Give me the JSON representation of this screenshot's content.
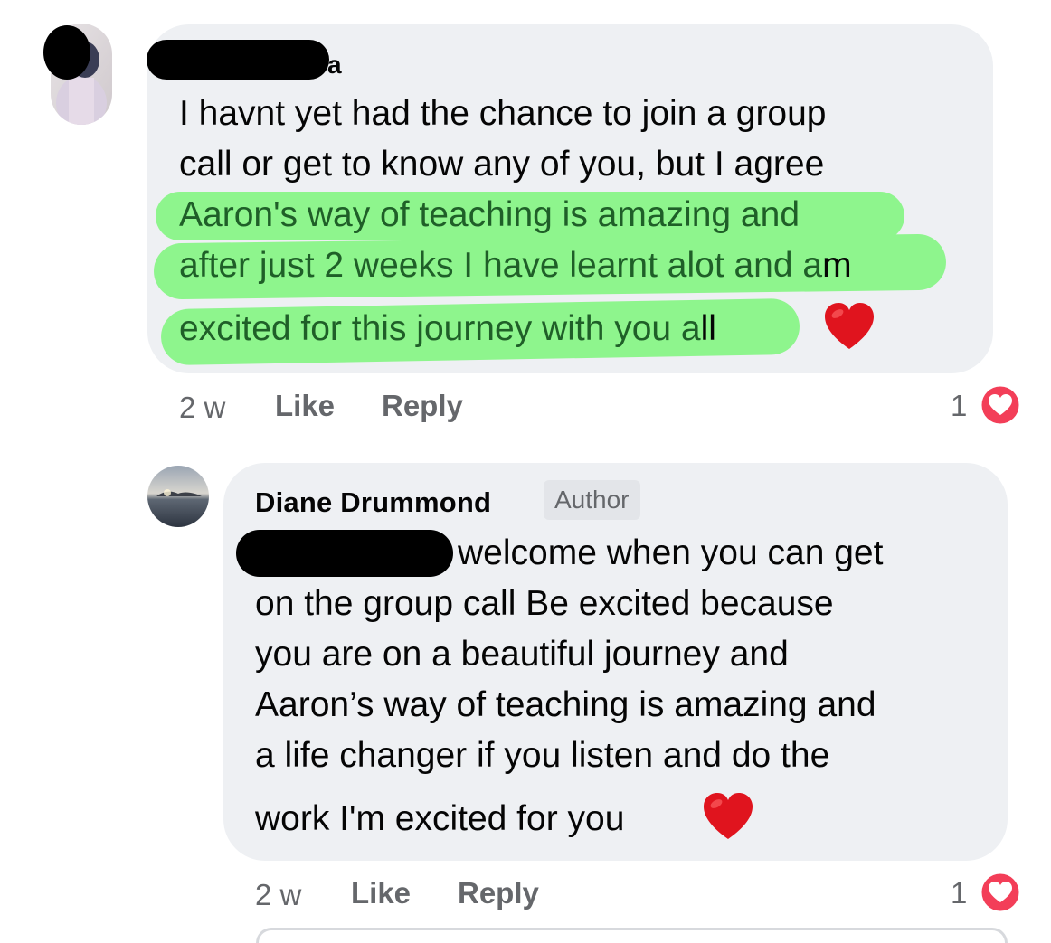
{
  "comments": [
    {
      "author_name_visible_fragment": "a",
      "lines": [
        "I havnt yet had the chance to join a group",
        "call or get to know any of you, but I agree",
        "Aaron's way of teaching is amazing and",
        "after just 2 weeks I have learnt alot and am",
        "excited for this journey with you all"
      ],
      "time": "2 w",
      "like_label": "Like",
      "reply_label": "Reply",
      "reaction_count": "1",
      "reaction_icon": "love-reaction-icon",
      "emoji": "red-heart"
    },
    {
      "author_name": "Diane Drummond",
      "badge": "Author",
      "lines": [
        "welcome when you can get",
        "on the group call Be excited because",
        "you are on a beautiful journey and",
        "Aaron’s way of teaching is amazing and",
        "a life changer if you listen and do the",
        "work I'm excited for you"
      ],
      "time": "2 w",
      "like_label": "Like",
      "reply_label": "Reply",
      "reaction_count": "1",
      "reaction_icon": "love-reaction-icon",
      "emoji": "red-heart"
    }
  ],
  "colors": {
    "bubble": "#eef0f3",
    "highlight": "#8ef58d",
    "meta_text": "#65676b",
    "love_reaction": "#f33e58"
  }
}
